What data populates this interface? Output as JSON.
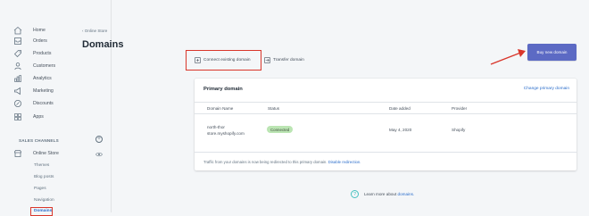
{
  "sidebar": {
    "items": [
      {
        "label": "Home",
        "icon": "home-icon"
      },
      {
        "label": "Orders",
        "icon": "orders-icon"
      },
      {
        "label": "Products",
        "icon": "products-icon"
      },
      {
        "label": "Customers",
        "icon": "customers-icon"
      },
      {
        "label": "Analytics",
        "icon": "analytics-icon"
      },
      {
        "label": "Marketing",
        "icon": "marketing-icon"
      },
      {
        "label": "Discounts",
        "icon": "discounts-icon"
      },
      {
        "label": "Apps",
        "icon": "apps-icon"
      }
    ],
    "sales_channels_heading": "SALES CHANNELS",
    "add_channel_symbol": "+",
    "online_store_label": "Online Store",
    "sub_items": [
      "Themes",
      "Blog posts",
      "Pages",
      "Navigation",
      "Domains"
    ]
  },
  "header": {
    "breadcrumb": "‹ Online Store",
    "title": "Domains",
    "connect_label": "Connect existing domain",
    "transfer_label": "Transfer domain",
    "buy_label": "Buy new domain"
  },
  "primary_domain": {
    "title": "Primary domain",
    "change_link": "Change primary domain",
    "columns": [
      "Domain Name",
      "Status",
      "Date added",
      "Provider"
    ],
    "row": {
      "domain_line1": "north-thor",
      "domain_line2": "store.myshopify.com",
      "status": "Connected",
      "date_added": "May 4, 2020",
      "provider": "Shopify"
    },
    "footer_text": "Traffic from your domains is now being redirected to this primary domain. ",
    "footer_link": "Disable redirection."
  },
  "learn_more": {
    "text": "Learn more about ",
    "link": "domains."
  },
  "colors": {
    "accent": "#5c6ac4",
    "link": "#2c6ecb",
    "badge_bg": "#bbe5b3",
    "highlight": "#d9362b"
  }
}
